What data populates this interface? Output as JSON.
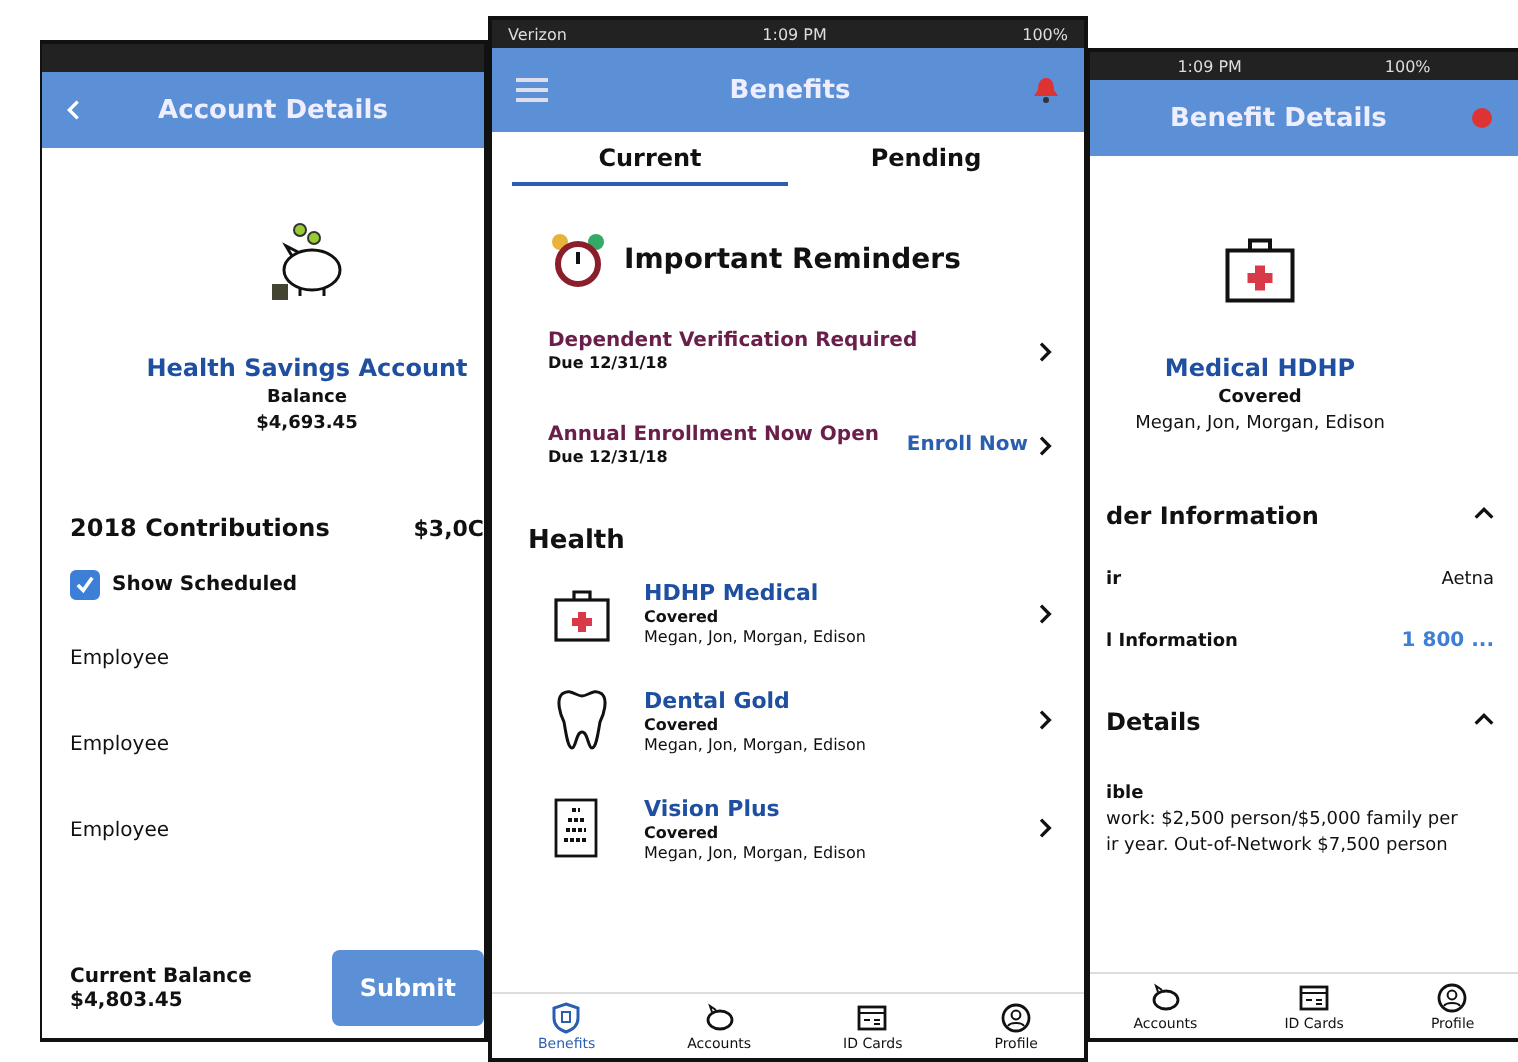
{
  "account_screen": {
    "title": "Account Details",
    "account_name": "Health Savings Account",
    "balance_label": "Balance",
    "balance": "$4,693.45",
    "contributions_title": "2018 Contributions",
    "contributions_total": "$3,0C",
    "show_scheduled": {
      "label": "Show Scheduled",
      "checked": true
    },
    "contributions": [
      {
        "label": "Employee"
      },
      {
        "label": "Employee"
      },
      {
        "label": "Employee"
      }
    ],
    "current_balance_label": "Current Balance",
    "current_balance": "$4,803.45",
    "submit": "Submit"
  },
  "benefits_screen": {
    "status": {
      "carrier": "Verizon",
      "time": "1:09 PM",
      "battery": "100%"
    },
    "title": "Benefits",
    "tabs": [
      {
        "label": "Current",
        "selected": true
      },
      {
        "label": "Pending",
        "selected": false
      }
    ],
    "reminders_title": "Important Reminders",
    "reminders": [
      {
        "title": "Dependent Verification Required",
        "due": "Due 12/31/18"
      },
      {
        "title": "Annual Enrollment Now Open",
        "due": "Due 12/31/18",
        "action": "Enroll Now"
      }
    ],
    "section": "Health",
    "plans": [
      {
        "kind": "medical",
        "name": "HDHP Medical",
        "status": "Covered",
        "members": "Megan, Jon, Morgan, Edison"
      },
      {
        "kind": "dental",
        "name": "Dental Gold",
        "status": "Covered",
        "members": "Megan, Jon, Morgan, Edison"
      },
      {
        "kind": "vision",
        "name": "Vision Plus",
        "status": "Covered",
        "members": "Megan, Jon, Morgan, Edison"
      }
    ],
    "nav": [
      {
        "kind": "benefits",
        "label": "Benefits",
        "selected": true
      },
      {
        "kind": "accounts",
        "label": "Accounts",
        "selected": false
      },
      {
        "kind": "cards",
        "label": "ID Cards",
        "selected": false
      },
      {
        "kind": "profile",
        "label": "Profile",
        "selected": false
      }
    ]
  },
  "details_screen": {
    "status": {
      "time": "1:09 PM",
      "battery": "100%"
    },
    "title": "Benefit Details",
    "plan_name": "Medical HDHP",
    "status_text": "Covered",
    "members": "Megan, Jon, Morgan, Edison",
    "sections": [
      {
        "title": "der Information",
        "expanded": true,
        "rows": [
          {
            "kind": "text",
            "label": "ir",
            "value": "Aetna"
          },
          {
            "kind": "link",
            "label": "l Information",
            "value": "1 800 ..."
          }
        ]
      },
      {
        "title": "Details",
        "expanded": true,
        "lines": [
          "ible",
          "work: $2,500 person/$5,000 family per",
          "ir year. Out-of-Network $7,500 person"
        ]
      }
    ],
    "nav": [
      {
        "kind": "accounts",
        "label": "Accounts"
      },
      {
        "kind": "cards",
        "label": "ID Cards"
      },
      {
        "kind": "profile",
        "label": "Profile"
      }
    ]
  }
}
